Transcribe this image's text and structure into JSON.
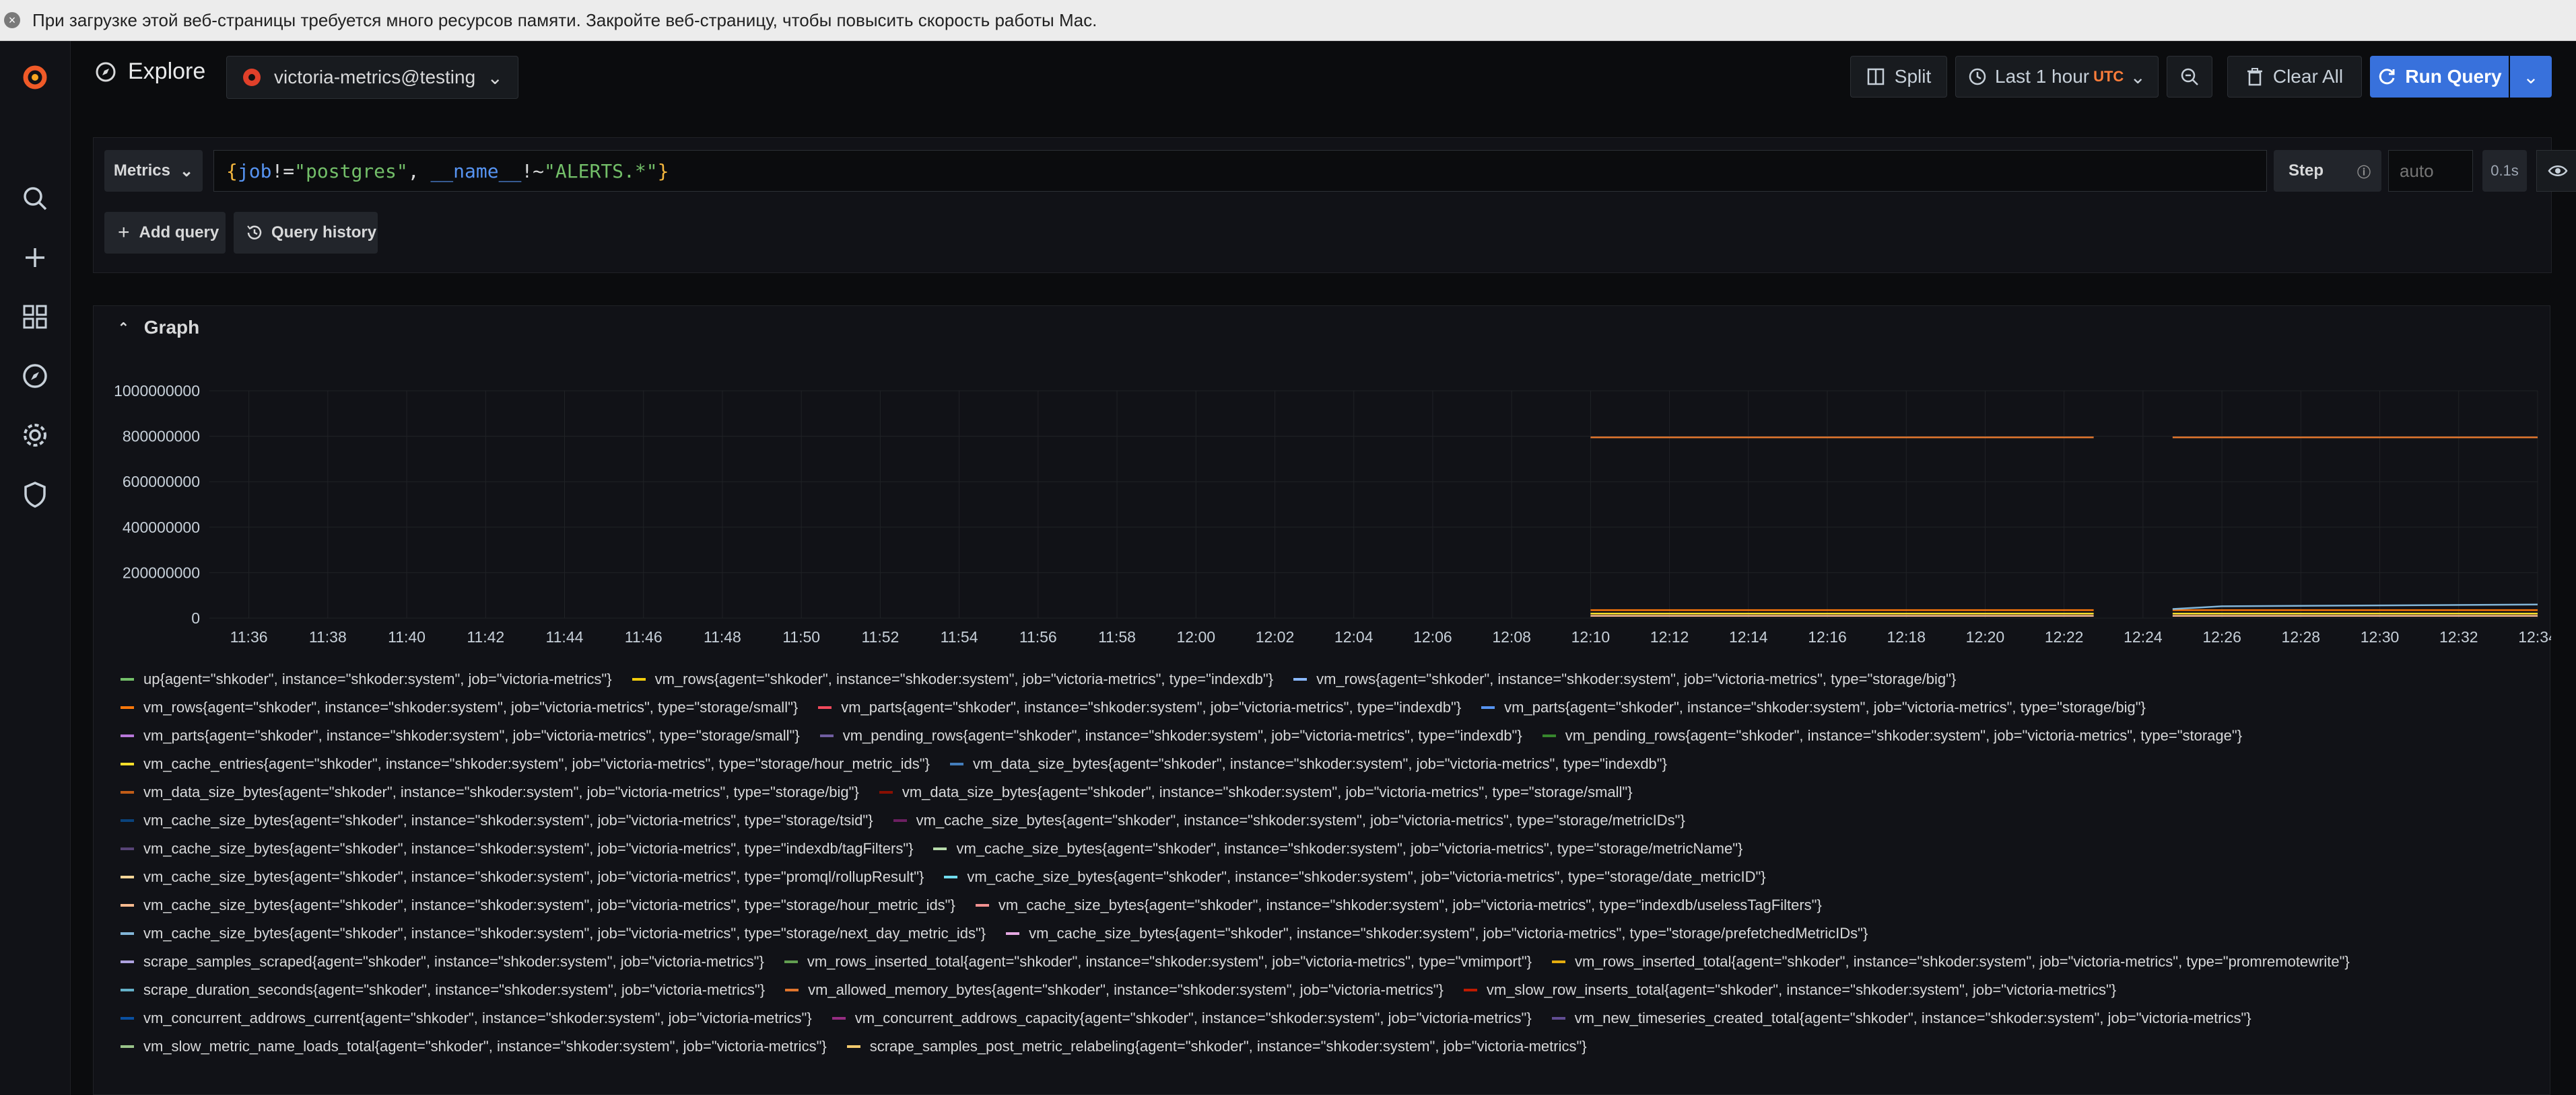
{
  "notification": {
    "text": "При загрузке этой веб-страницы требуется много ресурсов памяти. Закройте веб-страницу, чтобы повысить скорость работы Mac."
  },
  "sidebar": {
    "items": [
      {
        "icon": "grafana-logo-icon"
      },
      {
        "icon": "search-icon"
      },
      {
        "icon": "plus-icon"
      },
      {
        "icon": "dashboards-icon"
      },
      {
        "icon": "compass-icon"
      },
      {
        "icon": "gear-icon"
      },
      {
        "icon": "shield-icon"
      }
    ]
  },
  "header": {
    "title": "Explore",
    "datasource": "victoria-metrics@testing",
    "split_label": "Split",
    "time_range_label": "Last 1 hour",
    "timezone": "UTC",
    "clear_label": "Clear All",
    "run_label": "Run Query"
  },
  "query": {
    "mode_label": "Metrics",
    "expr_parts": {
      "open": "{",
      "label1": "job",
      "op1": "!=",
      "val1": "\"postgres\"",
      "sep": ", ",
      "label2": "__name__",
      "op2": "!~",
      "val2": "\"ALERTS.*\"",
      "close": "}"
    },
    "step_label": "Step",
    "step_placeholder": "auto",
    "query_time": "0.1s",
    "add_query_label": "Add query",
    "history_label": "Query history"
  },
  "graph": {
    "section_label": "Graph",
    "legend_rows": [
      [
        {
          "label": "up{agent=\"shkoder\", instance=\"shkoder:system\", job=\"victoria-metrics\"}",
          "color": "#73bf69"
        },
        {
          "label": "vm_rows{agent=\"shkoder\", instance=\"shkoder:system\", job=\"victoria-metrics\", type=\"indexdb\"}",
          "color": "#f2cc0c"
        },
        {
          "label": "vm_rows{agent=\"shkoder\", instance=\"shkoder:system\", job=\"victoria-metrics\", type=\"storage/big\"}",
          "color": "#8ab8ff"
        }
      ],
      [
        {
          "label": "vm_rows{agent=\"shkoder\", instance=\"shkoder:system\", job=\"victoria-metrics\", type=\"storage/small\"}",
          "color": "#ff780a"
        },
        {
          "label": "vm_parts{agent=\"shkoder\", instance=\"shkoder:system\", job=\"victoria-metrics\", type=\"indexdb\"}",
          "color": "#f2495c"
        },
        {
          "label": "vm_parts{agent=\"shkoder\", instance=\"shkoder:system\", job=\"victoria-metrics\", type=\"storage/big\"}",
          "color": "#5794f2"
        }
      ],
      [
        {
          "label": "vm_parts{agent=\"shkoder\", instance=\"shkoder:system\", job=\"victoria-metrics\", type=\"storage/small\"}",
          "color": "#b877d9"
        },
        {
          "label": "vm_pending_rows{agent=\"shkoder\", instance=\"shkoder:system\", job=\"victoria-metrics\", type=\"indexdb\"}",
          "color": "#705da0"
        },
        {
          "label": "vm_pending_rows{agent=\"shkoder\", instance=\"shkoder:system\", job=\"victoria-metrics\", type=\"storage\"}",
          "color": "#37872d"
        }
      ],
      [
        {
          "label": "vm_cache_entries{agent=\"shkoder\", instance=\"shkoder:system\", job=\"victoria-metrics\", type=\"storage/hour_metric_ids\"}",
          "color": "#fade2a"
        },
        {
          "label": "vm_data_size_bytes{agent=\"shkoder\", instance=\"shkoder:system\", job=\"victoria-metrics\", type=\"indexdb\"}",
          "color": "#447ebc"
        }
      ],
      [
        {
          "label": "vm_data_size_bytes{agent=\"shkoder\", instance=\"shkoder:system\", job=\"victoria-metrics\", type=\"storage/big\"}",
          "color": "#c15c17"
        },
        {
          "label": "vm_data_size_bytes{agent=\"shkoder\", instance=\"shkoder:system\", job=\"victoria-metrics\", type=\"storage/small\"}",
          "color": "#890f02"
        }
      ],
      [
        {
          "label": "vm_cache_size_bytes{agent=\"shkoder\", instance=\"shkoder:system\", job=\"victoria-metrics\", type=\"storage/tsid\"}",
          "color": "#0a437c"
        },
        {
          "label": "vm_cache_size_bytes{agent=\"shkoder\", instance=\"shkoder:system\", job=\"victoria-metrics\", type=\"storage/metricIDs\"}",
          "color": "#6d1f62"
        }
      ],
      [
        {
          "label": "vm_cache_size_bytes{agent=\"shkoder\", instance=\"shkoder:system\", job=\"victoria-metrics\", type=\"indexdb/tagFilters\"}",
          "color": "#584477"
        },
        {
          "label": "vm_cache_size_bytes{agent=\"shkoder\", instance=\"shkoder:system\", job=\"victoria-metrics\", type=\"storage/metricName\"}",
          "color": "#b7dbab"
        }
      ],
      [
        {
          "label": "vm_cache_size_bytes{agent=\"shkoder\", instance=\"shkoder:system\", job=\"victoria-metrics\", type=\"promql/rollupResult\"}",
          "color": "#f4d598"
        },
        {
          "label": "vm_cache_size_bytes{agent=\"shkoder\", instance=\"shkoder:system\", job=\"victoria-metrics\", type=\"storage/date_metricID\"}",
          "color": "#70dbed"
        }
      ],
      [
        {
          "label": "vm_cache_size_bytes{agent=\"shkoder\", instance=\"shkoder:system\", job=\"victoria-metrics\", type=\"storage/hour_metric_ids\"}",
          "color": "#f9ba8f"
        },
        {
          "label": "vm_cache_size_bytes{agent=\"shkoder\", instance=\"shkoder:system\", job=\"victoria-metrics\", type=\"indexdb/uselessTagFilters\"}",
          "color": "#f29191"
        }
      ],
      [
        {
          "label": "vm_cache_size_bytes{agent=\"shkoder\", instance=\"shkoder:system\", job=\"victoria-metrics\", type=\"storage/next_day_metric_ids\"}",
          "color": "#82b5d8"
        },
        {
          "label": "vm_cache_size_bytes{agent=\"shkoder\", instance=\"shkoder:system\", job=\"victoria-metrics\", type=\"storage/prefetchedMetricIDs\"}",
          "color": "#e5a8e2"
        }
      ],
      [
        {
          "label": "scrape_samples_scraped{agent=\"shkoder\", instance=\"shkoder:system\", job=\"victoria-metrics\"}",
          "color": "#aea2e0"
        },
        {
          "label": "vm_rows_inserted_total{agent=\"shkoder\", instance=\"shkoder:system\", job=\"victoria-metrics\", type=\"vmimport\"}",
          "color": "#629e51"
        },
        {
          "label": "vm_rows_inserted_total{agent=\"shkoder\", instance=\"shkoder:system\", job=\"victoria-metrics\", type=\"promremotewrite\"}",
          "color": "#e5ac0e"
        }
      ],
      [
        {
          "label": "scrape_duration_seconds{agent=\"shkoder\", instance=\"shkoder:system\", job=\"victoria-metrics\"}",
          "color": "#64b0c8"
        },
        {
          "label": "vm_allowed_memory_bytes{agent=\"shkoder\", instance=\"shkoder:system\", job=\"victoria-metrics\"}",
          "color": "#e0752d"
        },
        {
          "label": "vm_slow_row_inserts_total{agent=\"shkoder\", instance=\"shkoder:system\", job=\"victoria-metrics\"}",
          "color": "#bf1b00"
        }
      ],
      [
        {
          "label": "vm_concurrent_addrows_current{agent=\"shkoder\", instance=\"shkoder:system\", job=\"victoria-metrics\"}",
          "color": "#0a50a1"
        },
        {
          "label": "vm_concurrent_addrows_capacity{agent=\"shkoder\", instance=\"shkoder:system\", job=\"victoria-metrics\"}",
          "color": "#962d82"
        },
        {
          "label": "vm_new_timeseries_created_total{agent=\"shkoder\", instance=\"shkoder:system\", job=\"victoria-metrics\"}",
          "color": "#614d93"
        }
      ],
      [
        {
          "label": "vm_slow_metric_name_loads_total{agent=\"shkoder\", instance=\"shkoder:system\", job=\"victoria-metrics\"}",
          "color": "#9ac48a"
        },
        {
          "label": "scrape_samples_post_metric_relabeling{agent=\"shkoder\", instance=\"shkoder:system\", job=\"victoria-metrics\"}",
          "color": "#f2c96d"
        }
      ]
    ]
  },
  "chart_data": {
    "type": "line",
    "title": "",
    "xlabel": "",
    "ylabel": "",
    "x_ticks": [
      "11:36",
      "11:38",
      "11:40",
      "11:42",
      "11:44",
      "11:46",
      "11:48",
      "11:50",
      "11:52",
      "11:54",
      "11:56",
      "11:58",
      "12:00",
      "12:02",
      "12:04",
      "12:06",
      "12:08",
      "12:10",
      "12:12",
      "12:14",
      "12:16",
      "12:18",
      "12:20",
      "12:22",
      "12:24",
      "12:26",
      "12:28",
      "12:30",
      "12:32",
      "12:34"
    ],
    "y_ticks": [
      0,
      200000000,
      400000000,
      600000000,
      800000000,
      1000000000
    ],
    "y_tick_labels": [
      "0",
      "200000000",
      "400000000",
      "600000000",
      "800000000",
      "1000000000"
    ],
    "ylim": [
      0,
      1000000000
    ],
    "xlim": [
      "11:35:00",
      "12:34:00"
    ],
    "grid": true,
    "legend": "bottom",
    "series": [
      {
        "color": "#e0752d",
        "segments": [
          {
            "x": [
              "12:10:00",
              "12:22:45"
            ],
            "y": [
              795000000,
              795000000
            ]
          },
          {
            "x": [
              "12:24:45",
              "12:34:00"
            ],
            "y": [
              795000000,
              795000000
            ]
          }
        ]
      },
      {
        "color": "#ff780a",
        "segments": [
          {
            "x": [
              "12:10:00",
              "12:22:45"
            ],
            "y": [
              35000000,
              35000000
            ]
          },
          {
            "x": [
              "12:24:45",
              "12:34:00"
            ],
            "y": [
              35000000,
              35000000
            ]
          }
        ]
      },
      {
        "color": "#fade2a",
        "segments": [
          {
            "x": [
              "12:10:00",
              "12:22:45"
            ],
            "y": [
              20000000,
              20000000
            ]
          },
          {
            "x": [
              "12:24:45",
              "12:34:00"
            ],
            "y": [
              20000000,
              20000000
            ]
          }
        ]
      },
      {
        "color": "#f9ba8f",
        "segments": [
          {
            "x": [
              "12:10:00",
              "12:22:45"
            ],
            "y": [
              10000000,
              10000000
            ]
          },
          {
            "x": [
              "12:24:45",
              "12:34:00"
            ],
            "y": [
              10000000,
              10000000
            ]
          }
        ]
      },
      {
        "color": "#82b5d8",
        "segments": [
          {
            "x": [
              "12:24:45",
              "12:26:00",
              "12:34:00"
            ],
            "y": [
              40000000,
              52000000,
              60000000
            ]
          }
        ]
      }
    ]
  }
}
